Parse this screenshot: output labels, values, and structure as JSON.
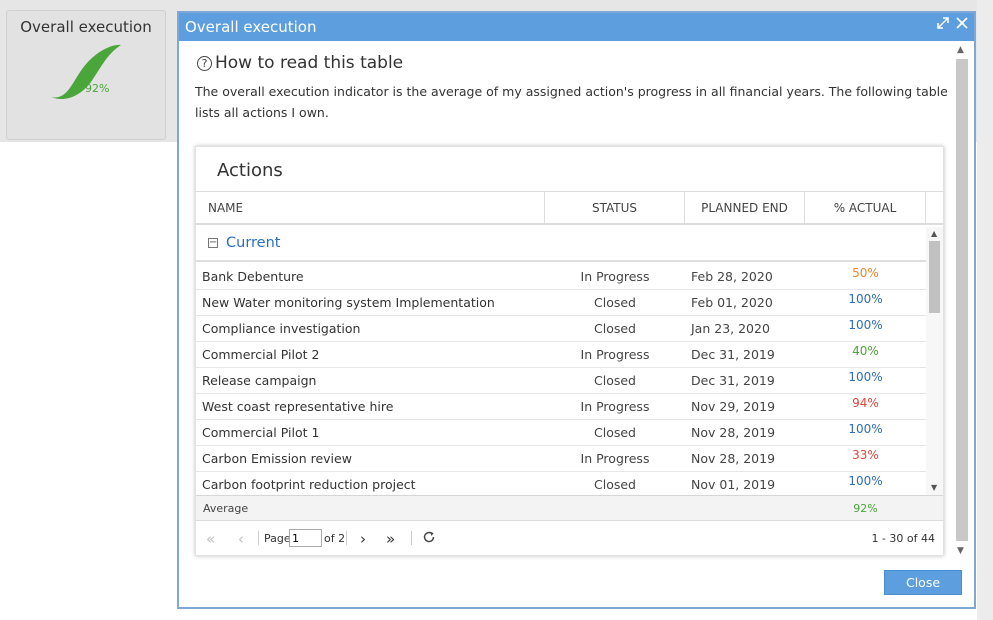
{
  "widget": {
    "title": "Overall execution",
    "percent": "92%",
    "colors": {
      "gauge": "#4aa53a"
    }
  },
  "modal": {
    "title": "Overall execution",
    "help_title": "How to read this table",
    "description": "The overall execution indicator is the average of my assigned action's progress in all financial years. The following table lists all actions I own.",
    "close_label": "Close"
  },
  "actions": {
    "title": "Actions",
    "columns": [
      "NAME",
      "STATUS",
      "PLANNED END",
      "% ACTUAL"
    ],
    "group": "Current",
    "rows": [
      {
        "name": "Bank Debenture",
        "status": "In Progress",
        "end": "Feb 28, 2020",
        "actual": "50%",
        "color": "#e8862e"
      },
      {
        "name": "New Water monitoring system Implementation",
        "status": "Closed",
        "end": "Feb 01, 2020",
        "actual": "100%",
        "color": "#2e6db4"
      },
      {
        "name": "Compliance investigation",
        "status": "Closed",
        "end": "Jan 23, 2020",
        "actual": "100%",
        "color": "#2e6db4"
      },
      {
        "name": "Commercial Pilot 2",
        "status": "In Progress",
        "end": "Dec 31, 2019",
        "actual": "40%",
        "color": "#4aa53a"
      },
      {
        "name": "Release campaign",
        "status": "Closed",
        "end": "Dec 31, 2019",
        "actual": "100%",
        "color": "#2e6db4"
      },
      {
        "name": "West coast representative hire",
        "status": "In Progress",
        "end": "Nov 29, 2019",
        "actual": "94%",
        "color": "#e0463a"
      },
      {
        "name": "Commercial Pilot 1",
        "status": "Closed",
        "end": "Nov 28, 2019",
        "actual": "100%",
        "color": "#2e6db4"
      },
      {
        "name": "Carbon Emission review",
        "status": "In Progress",
        "end": "Nov 28, 2019",
        "actual": "33%",
        "color": "#e0463a"
      },
      {
        "name": "Carbon footprint reduction project",
        "status": "Closed",
        "end": "Nov 01, 2019",
        "actual": "100%",
        "color": "#2e6db4"
      }
    ],
    "summary_label": "Average",
    "summary_value": "92%",
    "pager": {
      "page_label": "Page",
      "page_value": "1",
      "of_label": "of 2",
      "info": "1 - 30 of 44"
    }
  }
}
